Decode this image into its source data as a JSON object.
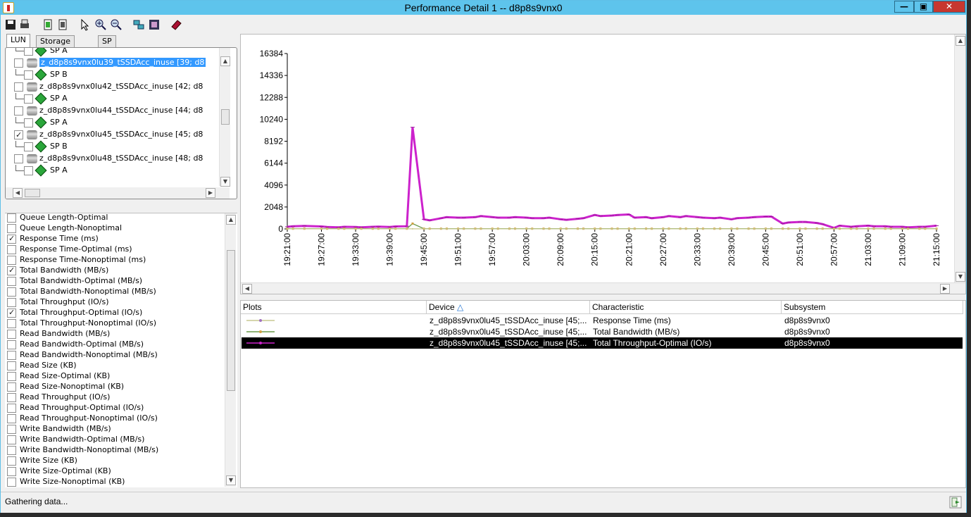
{
  "window": {
    "title": "Performance Detail 1 -- d8p8s9vnx0"
  },
  "tabs": [
    "LUN",
    "Storage Pool",
    "SP"
  ],
  "tree": [
    {
      "kind": "sp",
      "label": "SP A",
      "checked": false
    },
    {
      "kind": "lun",
      "label": "z_d8p8s9vnx0lu39_tSSDAcc_inuse [39; d8",
      "checked": false,
      "selected": true
    },
    {
      "kind": "sp",
      "label": "SP B",
      "checked": false
    },
    {
      "kind": "lun",
      "label": "z_d8p8s9vnx0lu42_tSSDAcc_inuse [42; d8",
      "checked": false
    },
    {
      "kind": "sp",
      "label": "SP A",
      "checked": false
    },
    {
      "kind": "lun",
      "label": "z_d8p8s9vnx0lu44_tSSDAcc_inuse [44; d8",
      "checked": false
    },
    {
      "kind": "sp",
      "label": "SP A",
      "checked": false
    },
    {
      "kind": "lun",
      "label": "z_d8p8s9vnx0lu45_tSSDAcc_inuse [45; d8",
      "checked": true
    },
    {
      "kind": "sp",
      "label": "SP B",
      "checked": false
    },
    {
      "kind": "lun",
      "label": "z_d8p8s9vnx0lu48_tSSDAcc_inuse [48; d8",
      "checked": false
    },
    {
      "kind": "sp",
      "label": "SP A",
      "checked": false
    }
  ],
  "metrics": [
    {
      "label": "Queue Length-Optimal",
      "checked": false
    },
    {
      "label": "Queue Length-Nonoptimal",
      "checked": false
    },
    {
      "label": "Response Time (ms)",
      "checked": true
    },
    {
      "label": "Response Time-Optimal (ms)",
      "checked": false
    },
    {
      "label": "Response Time-Nonoptimal (ms)",
      "checked": false
    },
    {
      "label": "Total Bandwidth (MB/s)",
      "checked": true
    },
    {
      "label": "Total Bandwidth-Optimal (MB/s)",
      "checked": false
    },
    {
      "label": "Total Bandwidth-Nonoptimal (MB/s)",
      "checked": false
    },
    {
      "label": "Total Throughput (IO/s)",
      "checked": false
    },
    {
      "label": "Total Throughput-Optimal (IO/s)",
      "checked": true
    },
    {
      "label": "Total Throughput-Nonoptimal (IO/s)",
      "checked": false
    },
    {
      "label": "Read Bandwidth (MB/s)",
      "checked": false
    },
    {
      "label": "Read Bandwidth-Optimal (MB/s)",
      "checked": false
    },
    {
      "label": "Read Bandwidth-Nonoptimal (MB/s)",
      "checked": false
    },
    {
      "label": "Read Size (KB)",
      "checked": false
    },
    {
      "label": "Read Size-Optimal (KB)",
      "checked": false
    },
    {
      "label": "Read Size-Nonoptimal (KB)",
      "checked": false
    },
    {
      "label": "Read Throughput (IO/s)",
      "checked": false
    },
    {
      "label": "Read Throughput-Optimal (IO/s)",
      "checked": false
    },
    {
      "label": "Read Throughput-Nonoptimal (IO/s)",
      "checked": false
    },
    {
      "label": "Write Bandwidth (MB/s)",
      "checked": false
    },
    {
      "label": "Write Bandwidth-Optimal (MB/s)",
      "checked": false
    },
    {
      "label": "Write Bandwidth-Nonoptimal (MB/s)",
      "checked": false
    },
    {
      "label": "Write Size (KB)",
      "checked": false
    },
    {
      "label": "Write Size-Optimal (KB)",
      "checked": false
    },
    {
      "label": "Write Size-Nonoptimal (KB)",
      "checked": false
    }
  ],
  "table": {
    "headers": [
      "Plots",
      "Device",
      "Characteristic",
      "Subsystem"
    ],
    "sort_indicator": "△",
    "rows": [
      {
        "plot_color": "#c8c890",
        "marker_color": "#a070c0",
        "device": "z_d8p8s9vnx0lu45_tSSDAcc_inuse [45;...",
        "characteristic": "Response Time (ms)",
        "subsystem": "d8p8s9vnx0"
      },
      {
        "plot_color": "#6a9a4a",
        "marker_color": "#d0a040",
        "device": "z_d8p8s9vnx0lu45_tSSDAcc_inuse [45;...",
        "characteristic": "Total Bandwidth (MB/s)",
        "subsystem": "d8p8s9vnx0"
      },
      {
        "plot_color": "#cc22cc",
        "marker_color": "#cc22cc",
        "device": "z_d8p8s9vnx0lu45_tSSDAcc_inuse [45;...",
        "characteristic": "Total Throughput-Optimal (IO/s)",
        "subsystem": "d8p8s9vnx0",
        "selected": true
      }
    ]
  },
  "status": {
    "text": "Gathering data..."
  },
  "chart_data": {
    "type": "line",
    "ylim": [
      0,
      16384
    ],
    "yticks": [
      0,
      2048,
      4096,
      6144,
      8192,
      10240,
      12288,
      14336,
      16384
    ],
    "xticks": [
      "19:21:00",
      "19:27:00",
      "19:33:00",
      "19:39:00",
      "19:45:00",
      "19:51:00",
      "19:57:00",
      "20:03:00",
      "20:09:00",
      "20:15:00",
      "20:21:00",
      "20:27:00",
      "20:33:00",
      "20:39:00",
      "20:45:00",
      "20:51:00",
      "20:57:00",
      "21:03:00",
      "21:09:00",
      "21:15:00"
    ],
    "x": [
      "19:21",
      "19:22",
      "19:24",
      "19:27",
      "19:28",
      "19:30",
      "19:31",
      "19:33",
      "19:34",
      "19:36",
      "19:37",
      "19:39",
      "19:40",
      "19:42",
      "19:43",
      "19:45",
      "19:46",
      "19:48",
      "19:49",
      "19:51",
      "19:52",
      "19:54",
      "19:55",
      "19:57",
      "19:58",
      "20:00",
      "20:01",
      "20:03",
      "20:04",
      "20:06",
      "20:07",
      "20:09",
      "20:10",
      "20:12",
      "20:13",
      "20:15",
      "20:16",
      "20:18",
      "20:19",
      "20:21",
      "20:22",
      "20:24",
      "20:25",
      "20:27",
      "20:28",
      "20:30",
      "20:31",
      "20:33",
      "20:34",
      "20:36",
      "20:37",
      "20:39",
      "20:40",
      "20:42",
      "20:43",
      "20:45",
      "20:46",
      "20:48",
      "20:49",
      "20:51",
      "20:52",
      "20:54",
      "20:55",
      "20:57",
      "20:58",
      "21:00",
      "21:01",
      "21:03",
      "21:04",
      "21:06",
      "21:07",
      "21:09",
      "21:10",
      "21:12",
      "21:13",
      "21:15"
    ],
    "series": [
      {
        "name": "Total Throughput-Optimal (IO/s)",
        "color": "#cc22cc",
        "values": [
          200,
          250,
          280,
          230,
          180,
          150,
          200,
          180,
          150,
          200,
          220,
          180,
          230,
          250,
          9500,
          900,
          800,
          1000,
          1100,
          1050,
          1050,
          1100,
          1200,
          1100,
          1050,
          1050,
          1100,
          1050,
          1000,
          1000,
          1050,
          900,
          850,
          950,
          1000,
          1300,
          1200,
          1250,
          1300,
          1350,
          1050,
          1100,
          1000,
          1100,
          1200,
          1100,
          1200,
          1100,
          1050,
          1000,
          1050,
          900,
          1000,
          1050,
          1100,
          1150,
          1150,
          500,
          600,
          650,
          650,
          550,
          450,
          100,
          300,
          200,
          250,
          300,
          250,
          250,
          200,
          200,
          150,
          200,
          200,
          300
        ]
      },
      {
        "name": "Total Bandwidth (MB/s)",
        "color": "#6a9a4a",
        "values": [
          20,
          20,
          20,
          20,
          20,
          20,
          20,
          20,
          20,
          20,
          20,
          20,
          20,
          20,
          500,
          20,
          20,
          20,
          20,
          20,
          20,
          20,
          20,
          20,
          20,
          20,
          20,
          20,
          20,
          20,
          20,
          20,
          20,
          20,
          20,
          20,
          20,
          20,
          20,
          20,
          20,
          20,
          20,
          20,
          20,
          20,
          20,
          20,
          20,
          20,
          20,
          20,
          20,
          20,
          20,
          20,
          20,
          20,
          20,
          20,
          20,
          20,
          20,
          20,
          20,
          20,
          20,
          20,
          20,
          20,
          20,
          20,
          20,
          20,
          20,
          20
        ]
      },
      {
        "name": "Response Time (ms)",
        "color": "#c8c890",
        "values": [
          5,
          5,
          5,
          5,
          5,
          5,
          5,
          5,
          5,
          5,
          5,
          5,
          5,
          5,
          5,
          5,
          5,
          5,
          5,
          5,
          5,
          5,
          5,
          5,
          5,
          5,
          5,
          5,
          5,
          5,
          5,
          5,
          5,
          5,
          5,
          5,
          5,
          5,
          5,
          5,
          5,
          5,
          5,
          5,
          5,
          5,
          5,
          5,
          5,
          5,
          5,
          5,
          5,
          5,
          5,
          5,
          5,
          5,
          5,
          5,
          5,
          5,
          5,
          5,
          5,
          5,
          5,
          5,
          5,
          5,
          5,
          5,
          5,
          5,
          5,
          5
        ]
      }
    ]
  }
}
